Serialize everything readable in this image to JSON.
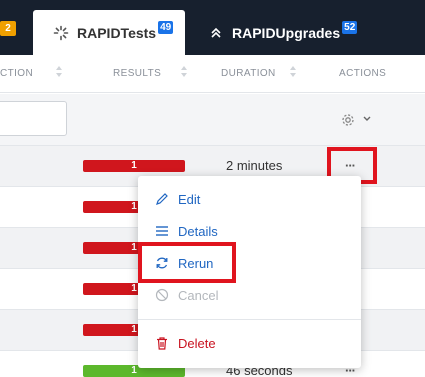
{
  "tabs": {
    "left_badge": "2",
    "active": {
      "label": "RAPIDTests",
      "count": "49"
    },
    "inactive": {
      "label": "RAPIDUpgrades",
      "count": "52"
    }
  },
  "table": {
    "headers": {
      "action": "CTION",
      "results": "RESULTS",
      "duration": "DURATION",
      "actions": "ACTIONS"
    },
    "rows": [
      {
        "result": "1",
        "status": "fail",
        "duration": "2 minutes"
      },
      {
        "result": "1",
        "status": "fail",
        "duration": ""
      },
      {
        "result": "1",
        "status": "fail",
        "duration": ""
      },
      {
        "result": "1",
        "status": "fail",
        "duration": ""
      },
      {
        "result": "1",
        "status": "fail",
        "duration": ""
      },
      {
        "result": "1",
        "status": "pass",
        "duration": "46 seconds"
      }
    ],
    "row_actions_label": "···"
  },
  "menu": {
    "edit": "Edit",
    "details": "Details",
    "rerun": "Rerun",
    "cancel": "Cancel",
    "delete": "Delete"
  },
  "colors": {
    "tabbar": "#17202e",
    "fail": "#d0161d",
    "pass": "#5cb82c",
    "highlight": "#e0141e",
    "link_blue": "#2167c2",
    "danger": "#c91320"
  }
}
